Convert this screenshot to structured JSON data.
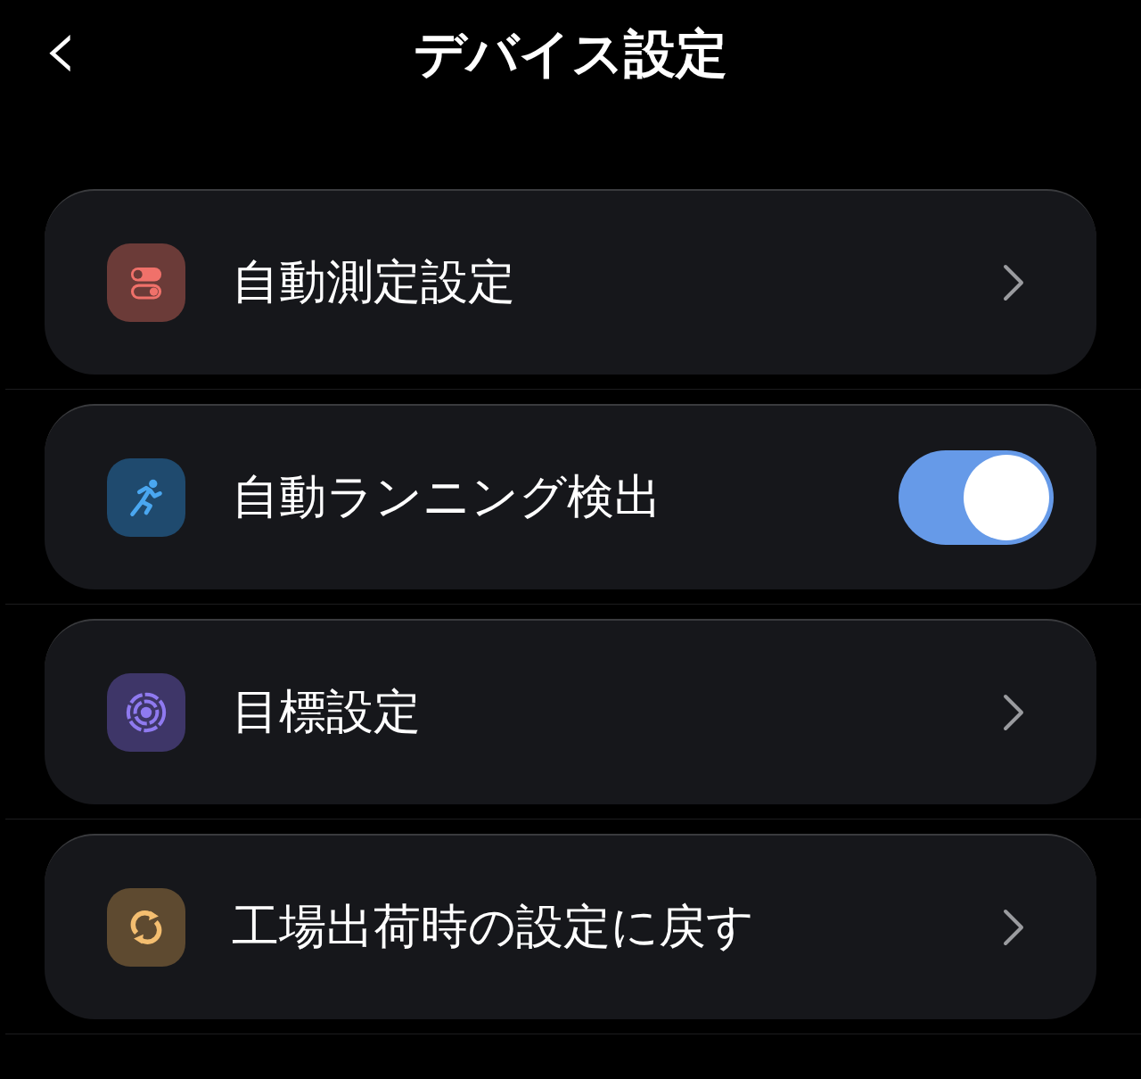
{
  "header": {
    "back_icon": "‹",
    "title": "デバイス設定"
  },
  "items": [
    {
      "kind": "link",
      "label": "自動測定設定"
    },
    {
      "kind": "toggle",
      "label": "自動ランニング検出",
      "on": true
    },
    {
      "kind": "link",
      "label": "目標設定"
    },
    {
      "kind": "link",
      "label": "工場出荷時の設定に戻す"
    }
  ]
}
